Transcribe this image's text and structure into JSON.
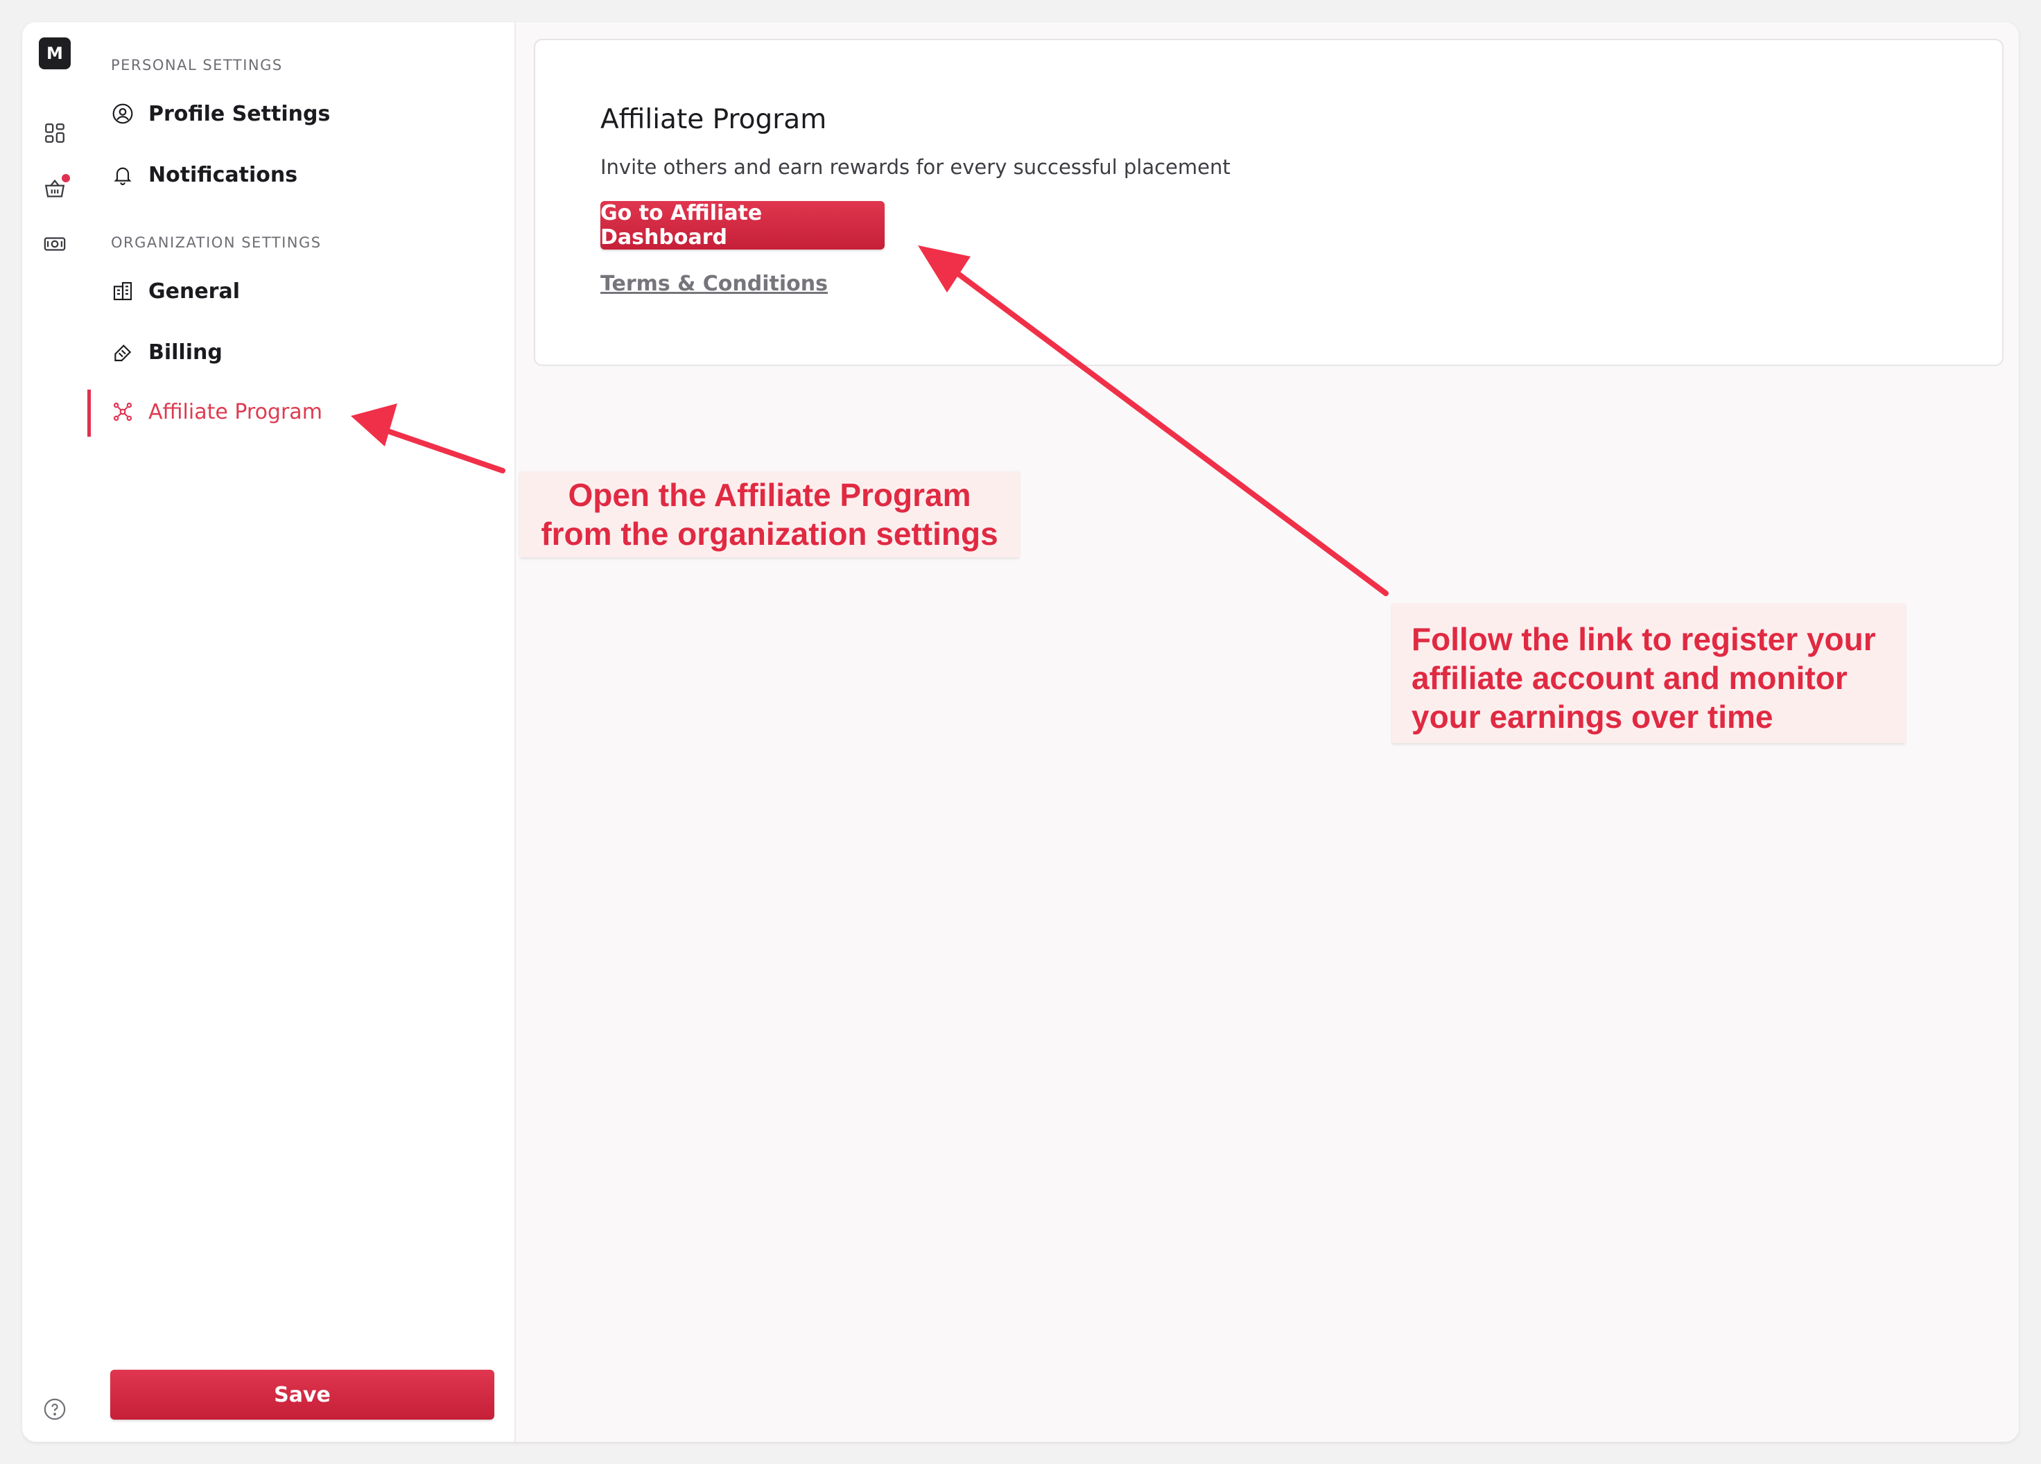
{
  "rail": {
    "logo_letter": "M",
    "items": [
      {
        "icon": "dashboard-grid-icon"
      },
      {
        "icon": "basket-icon",
        "has_notification": true
      },
      {
        "icon": "cash-icon"
      }
    ],
    "help_icon": "help-circle-icon"
  },
  "sidebar": {
    "personal_label": "PERSONAL SETTINGS",
    "personal_items": [
      {
        "label": "Profile Settings",
        "icon": "user-circle-icon"
      },
      {
        "label": "Notifications",
        "icon": "bell-icon"
      }
    ],
    "org_label": "ORGANIZATION SETTINGS",
    "org_items": [
      {
        "label": "General",
        "icon": "building-icon"
      },
      {
        "label": "Billing",
        "icon": "receipt-icon"
      },
      {
        "label": "Affiliate Program",
        "icon": "affiliate-network-icon",
        "active": true
      }
    ],
    "save_label": "Save"
  },
  "main": {
    "title": "Affiliate Program",
    "description": "Invite others and earn rewards for every successful placement",
    "dashboard_button": "Go to Affiliate Dashboard",
    "terms_link": "Terms & Conditions"
  },
  "annotations": {
    "left_callout": [
      "Open the Affiliate Program",
      "from the organization settings"
    ],
    "right_callout": [
      "Follow the link to register your",
      "affiliate account and monitor",
      "your earnings over time"
    ]
  },
  "colors": {
    "accent": "#e03050",
    "annotation_text": "#e02a42",
    "annotation_bg": "#fdeeee"
  }
}
